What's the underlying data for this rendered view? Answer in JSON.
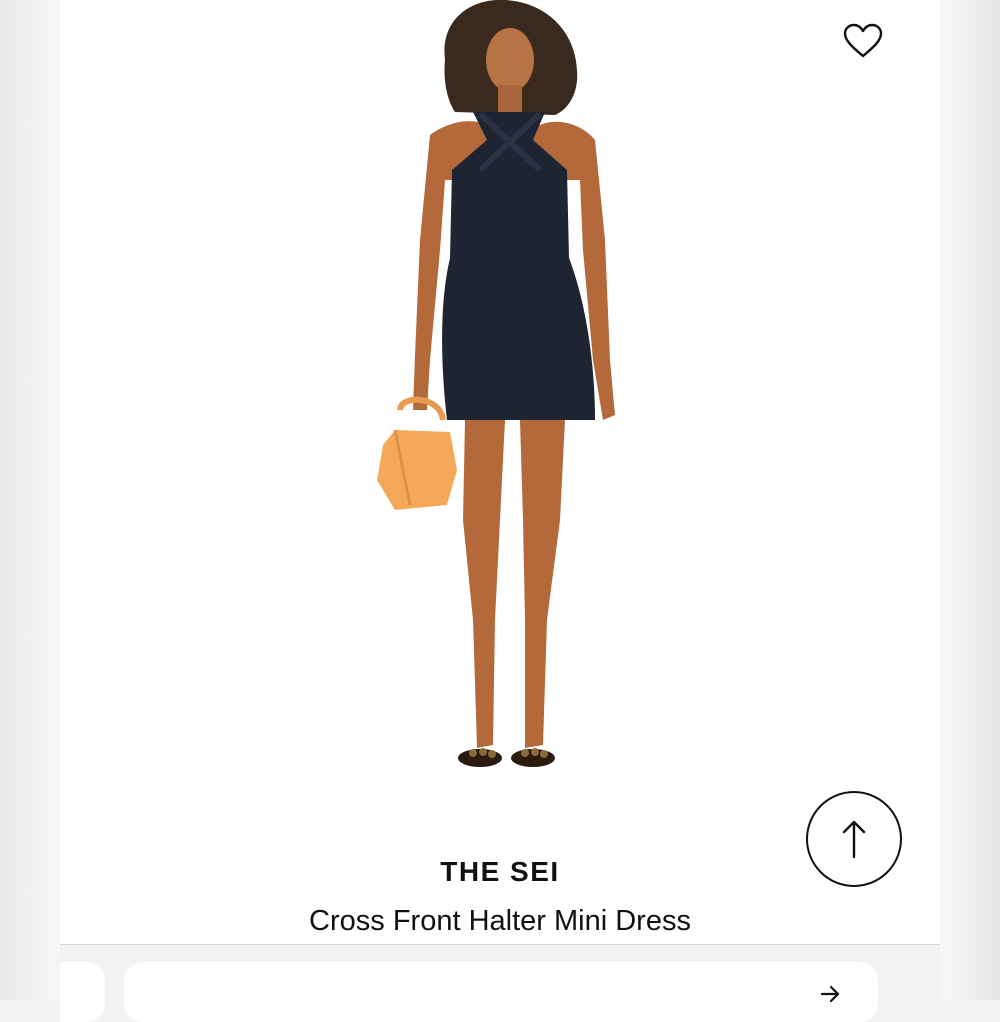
{
  "product": {
    "brand": "THE SEI",
    "name": "Cross Front Halter Mini Dress"
  },
  "icons": {
    "favorite": "heart-outline-icon",
    "scroll_top": "arrow-up-icon",
    "next": "arrow-right-icon"
  },
  "colors": {
    "text": "#111111",
    "dress": "#1f2433",
    "bag": "#f5a85a",
    "background": "#ffffff"
  }
}
